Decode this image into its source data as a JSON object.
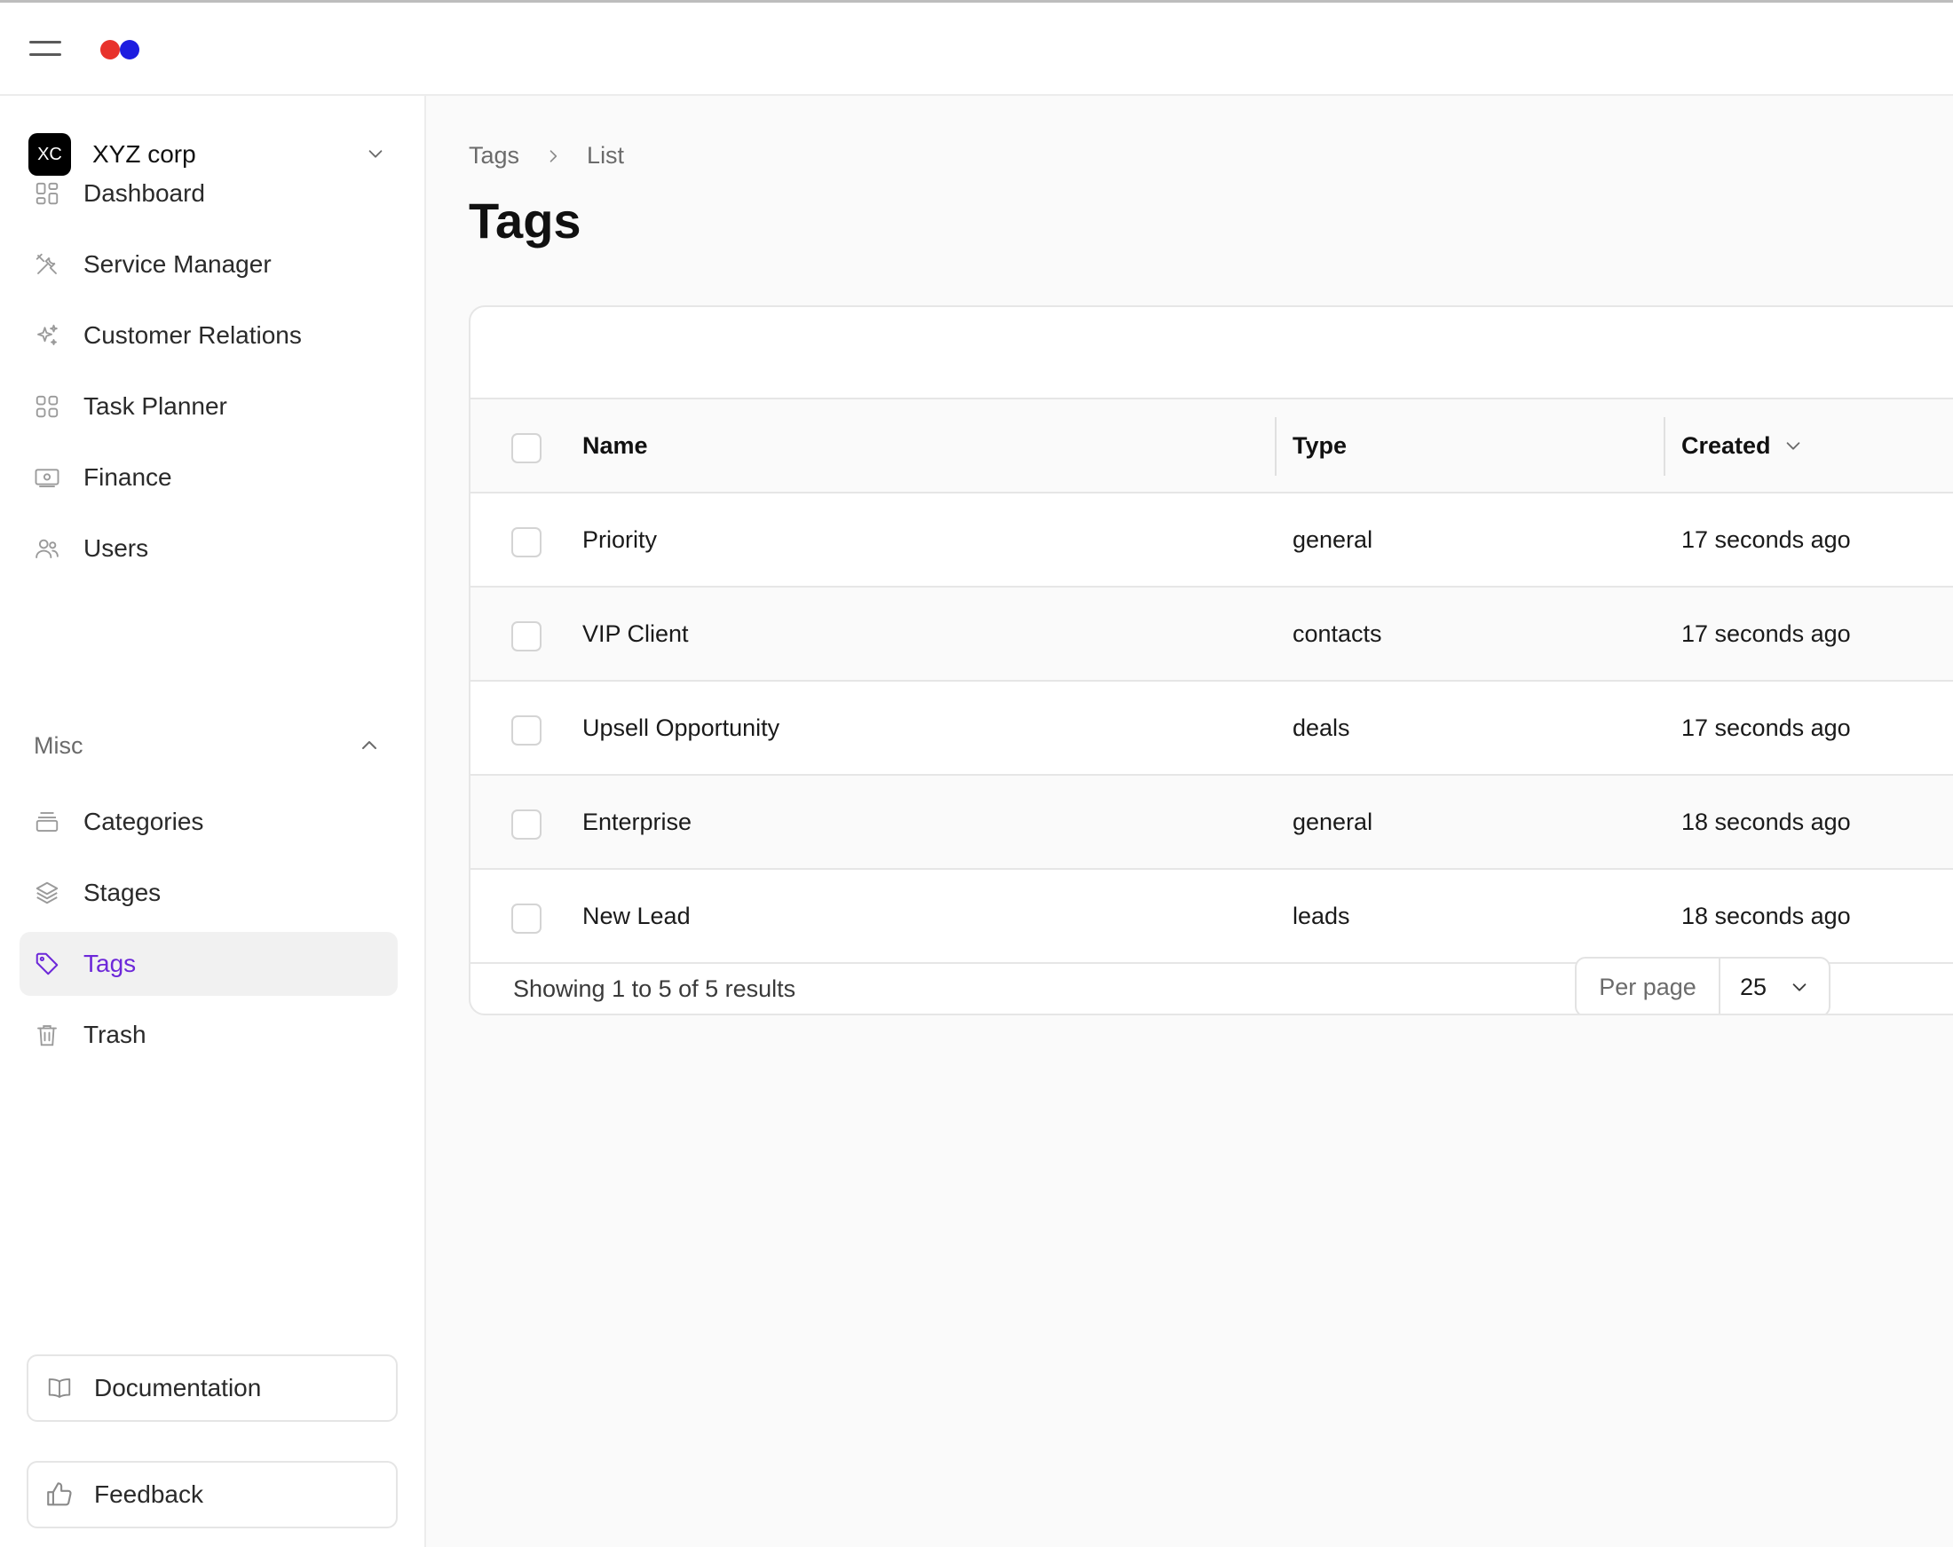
{
  "brand": {
    "dot_left_color": "#e8322b",
    "dot_right_color": "#1d1de0"
  },
  "org": {
    "badge": "XC",
    "name": "XYZ corp"
  },
  "nav": [
    {
      "label": "Dashboard",
      "icon": "dashboard-icon"
    },
    {
      "label": "Service Manager",
      "icon": "tools-icon"
    },
    {
      "label": "Customer Relations",
      "icon": "sparkles-icon"
    },
    {
      "label": "Task Planner",
      "icon": "grid-icon"
    },
    {
      "label": "Finance",
      "icon": "banknote-icon"
    },
    {
      "label": "Users",
      "icon": "users-icon"
    }
  ],
  "misc": {
    "label": "Misc",
    "items": [
      {
        "label": "Categories",
        "icon": "archive-icon"
      },
      {
        "label": "Stages",
        "icon": "layers-icon"
      },
      {
        "label": "Tags",
        "icon": "tag-icon",
        "active": true
      },
      {
        "label": "Trash",
        "icon": "trash-icon"
      }
    ]
  },
  "bottom": {
    "documentation": "Documentation",
    "feedback": "Feedback"
  },
  "breadcrumb": {
    "first": "Tags",
    "second": "List"
  },
  "page_title": "Tags",
  "table": {
    "headers": {
      "name": "Name",
      "type": "Type",
      "created": "Created"
    },
    "rows": [
      {
        "name": "Priority",
        "type": "general",
        "created": "17 seconds ago"
      },
      {
        "name": "VIP Client",
        "type": "contacts",
        "created": "17 seconds ago"
      },
      {
        "name": "Upsell Opportunity",
        "type": "deals",
        "created": "17 seconds ago"
      },
      {
        "name": "Enterprise",
        "type": "general",
        "created": "18 seconds ago"
      },
      {
        "name": "New Lead",
        "type": "leads",
        "created": "18 seconds ago"
      }
    ],
    "showing": "Showing 1 to 5 of 5 results",
    "per_page_label": "Per page",
    "per_page_value": "25"
  },
  "accent_color": "#6d28d9"
}
